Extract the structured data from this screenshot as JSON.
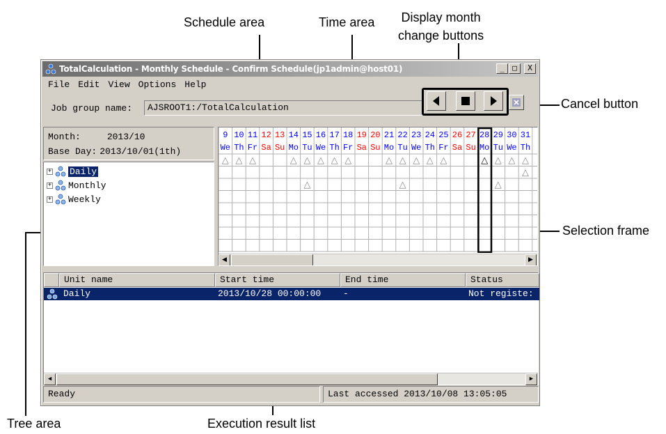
{
  "callouts": {
    "schedule_area": "Schedule area",
    "time_area": "Time area",
    "display_month_change_buttons": "Display month\nchange buttons",
    "cancel_button": "Cancel button",
    "selection_frame": "Selection frame",
    "tree_area": "Tree area",
    "execution_result_list": "Execution result list"
  },
  "window": {
    "title": "TotalCalculation - Monthly Schedule - Confirm Schedule(jp1admin@host01)",
    "title_buttons": [
      "_",
      "□",
      "X"
    ]
  },
  "menu": [
    "File",
    "Edit",
    "View",
    "Options",
    "Help"
  ],
  "job_group": {
    "label": "Job group name:",
    "value": "AJSROOT1:/TotalCalculation"
  },
  "month_panel": {
    "month_label": "Month:",
    "month_value": "2013/10",
    "base_label": "Base Day:",
    "base_value": "2013/10/01(1th)"
  },
  "tree": [
    {
      "label": "Daily",
      "selected": true
    },
    {
      "label": "Monthly",
      "selected": false
    },
    {
      "label": "Weekly",
      "selected": false
    }
  ],
  "calendar": {
    "days": [
      "9",
      "10",
      "11",
      "12",
      "13",
      "14",
      "15",
      "16",
      "17",
      "18",
      "19",
      "20",
      "21",
      "22",
      "23",
      "24",
      "25",
      "26",
      "27",
      "28",
      "29",
      "30",
      "31"
    ],
    "weekdays": [
      "We",
      "Th",
      "Fr",
      "Sa",
      "Su",
      "Mo",
      "Tu",
      "We",
      "Th",
      "Fr",
      "Sa",
      "Su",
      "Mo",
      "Tu",
      "We",
      "Th",
      "Fr",
      "Sa",
      "Su",
      "Mo",
      "Tu",
      "We",
      "Th"
    ],
    "weekend_color": "#ff0000",
    "weekday_color": "#0000ff",
    "schedule_marks": [
      {
        "row": 0,
        "cols": [
          0,
          1,
          2,
          5,
          6,
          7,
          8,
          9,
          12,
          13,
          14,
          15,
          16,
          19,
          20,
          21,
          22
        ],
        "bold_col": 19
      },
      {
        "row": 1,
        "cols": [
          22
        ]
      },
      {
        "row": 2,
        "cols": [
          6,
          13,
          20
        ]
      }
    ],
    "mark_symbol": "△",
    "selected_day": "28"
  },
  "result_list": {
    "headers": [
      "Unit name",
      "Start time",
      "End time",
      "Status"
    ],
    "rows": [
      {
        "unit": "Daily",
        "start": "2013/10/28 00:00:00",
        "end": "-",
        "status": "Not registe:"
      }
    ]
  },
  "statusbar": {
    "left": "Ready",
    "right": "Last accessed 2013/10/08 13:05:05"
  }
}
